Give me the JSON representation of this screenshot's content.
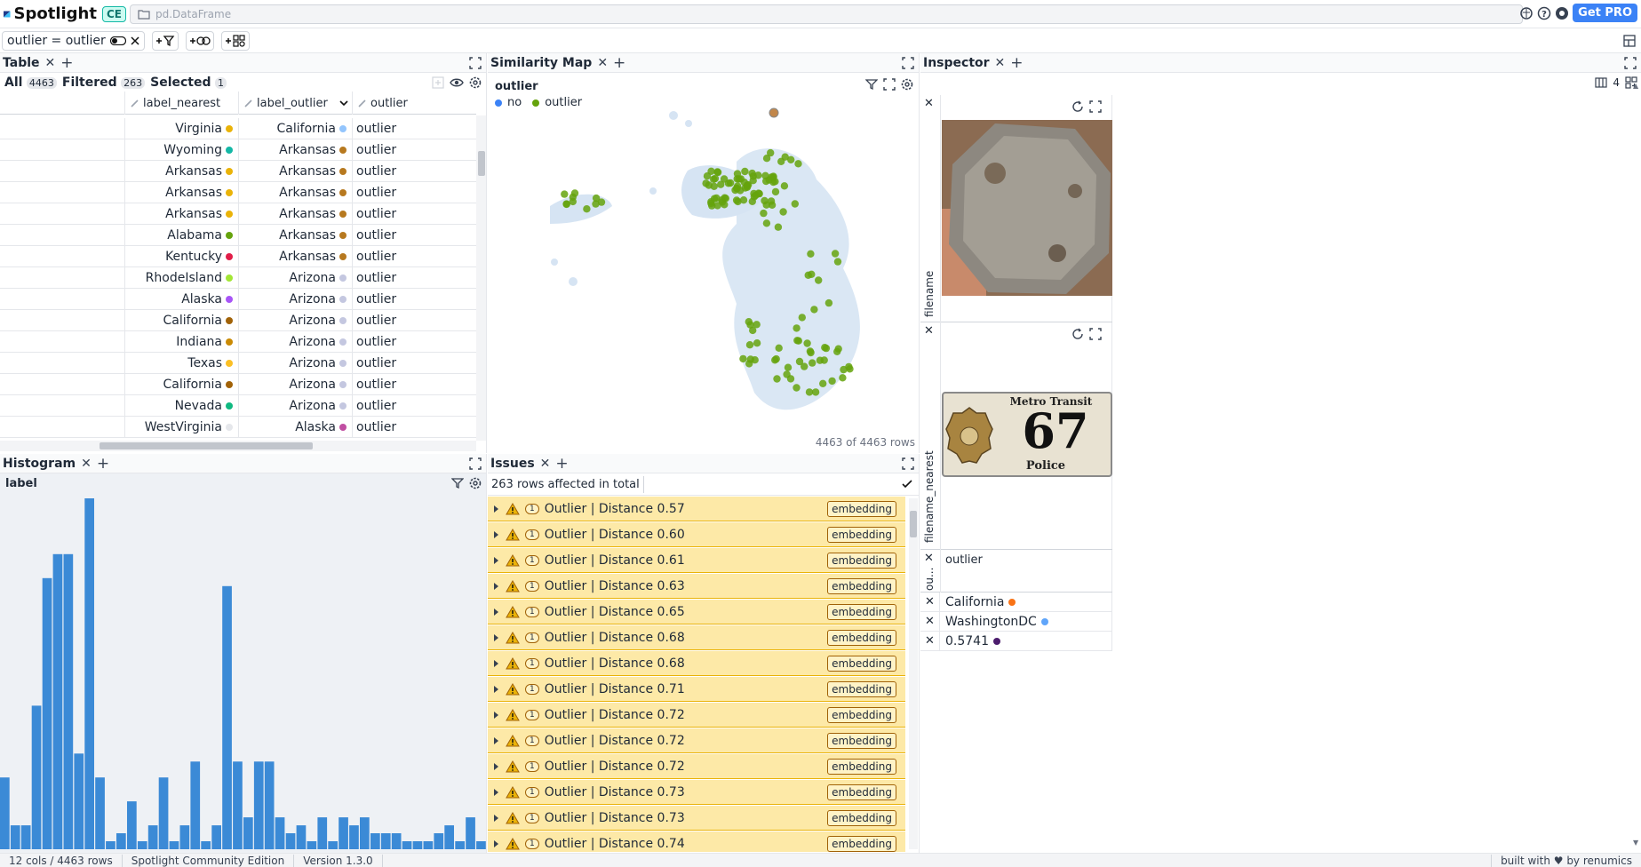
{
  "app": {
    "name": "Spotlight",
    "edition_badge": "CE",
    "path": "pd.DataFrame",
    "get_pro": "Get PRO"
  },
  "filter": {
    "text": "outlier = outlier"
  },
  "table": {
    "title": "Table",
    "tabs": {
      "all_label": "All",
      "all_count": "4463",
      "filtered_label": "Filtered",
      "filtered_count": "263",
      "selected_label": "Selected",
      "selected_count": "1"
    },
    "columns": [
      "label_nearest",
      "label_outlier",
      "outlier"
    ],
    "rows": [
      {
        "nearest": "Virginia",
        "nearest_color": "#eab308",
        "outlier_label": "California",
        "outlier_color": "#93c5fd",
        "outlier": "outlier"
      },
      {
        "nearest": "Wyoming",
        "nearest_color": "#14b8a6",
        "outlier_label": "Arkansas",
        "outlier_color": "#b7791f",
        "outlier": "outlier"
      },
      {
        "nearest": "Arkansas",
        "nearest_color": "#eab308",
        "outlier_label": "Arkansas",
        "outlier_color": "#b7791f",
        "outlier": "outlier"
      },
      {
        "nearest": "Arkansas",
        "nearest_color": "#eab308",
        "outlier_label": "Arkansas",
        "outlier_color": "#b7791f",
        "outlier": "outlier"
      },
      {
        "nearest": "Arkansas",
        "nearest_color": "#eab308",
        "outlier_label": "Arkansas",
        "outlier_color": "#b7791f",
        "outlier": "outlier"
      },
      {
        "nearest": "Alabama",
        "nearest_color": "#65a30d",
        "outlier_label": "Arkansas",
        "outlier_color": "#b7791f",
        "outlier": "outlier"
      },
      {
        "nearest": "Kentucky",
        "nearest_color": "#e11d48",
        "outlier_label": "Arkansas",
        "outlier_color": "#b7791f",
        "outlier": "outlier"
      },
      {
        "nearest": "RhodeIsland",
        "nearest_color": "#a3e635",
        "outlier_label": "Arizona",
        "outlier_color": "#c4c7e0",
        "outlier": "outlier"
      },
      {
        "nearest": "Alaska",
        "nearest_color": "#a855f7",
        "outlier_label": "Arizona",
        "outlier_color": "#c4c7e0",
        "outlier": "outlier"
      },
      {
        "nearest": "California",
        "nearest_color": "#a16207",
        "outlier_label": "Arizona",
        "outlier_color": "#c4c7e0",
        "outlier": "outlier"
      },
      {
        "nearest": "Indiana",
        "nearest_color": "#ca8a04",
        "outlier_label": "Arizona",
        "outlier_color": "#c4c7e0",
        "outlier": "outlier"
      },
      {
        "nearest": "Texas",
        "nearest_color": "#fbbf24",
        "outlier_label": "Arizona",
        "outlier_color": "#c4c7e0",
        "outlier": "outlier"
      },
      {
        "nearest": "California",
        "nearest_color": "#a16207",
        "outlier_label": "Arizona",
        "outlier_color": "#c4c7e0",
        "outlier": "outlier"
      },
      {
        "nearest": "Nevada",
        "nearest_color": "#10b981",
        "outlier_label": "Arizona",
        "outlier_color": "#c4c7e0",
        "outlier": "outlier"
      },
      {
        "nearest": "WestVirginia",
        "nearest_color": "#e5e7eb",
        "outlier_label": "Alaska",
        "outlier_color": "#c04ea2",
        "outlier": "outlier"
      }
    ]
  },
  "similarity_map": {
    "title": "Similarity Map",
    "legend_title": "outlier",
    "legend": [
      {
        "label": "no",
        "color": "#3b82f6"
      },
      {
        "label": "outlier",
        "color": "#65a30d"
      }
    ],
    "footer": "4463 of 4463 rows"
  },
  "histogram": {
    "title": "Histogram",
    "column": "label",
    "bar_color": "#3b8ad6"
  },
  "chart_data": {
    "type": "bar",
    "title": "",
    "xlabel": "",
    "ylabel": "",
    "values": [
      9,
      3,
      3,
      18,
      34,
      37,
      37,
      12,
      44,
      9,
      1,
      2,
      6,
      1,
      3,
      9,
      1,
      3,
      11,
      1,
      3,
      33,
      11,
      4,
      11,
      11,
      4,
      2,
      3,
      1,
      4,
      1,
      4,
      3,
      4,
      2,
      2,
      2,
      1,
      1,
      1,
      2,
      3,
      1,
      4,
      1
    ]
  },
  "issues": {
    "title": "Issues",
    "summary": "263 rows affected in total",
    "items": [
      {
        "text": "Outlier | Distance 0.57",
        "tag": "embedding",
        "count": "1"
      },
      {
        "text": "Outlier | Distance 0.60",
        "tag": "embedding",
        "count": "1"
      },
      {
        "text": "Outlier | Distance 0.61",
        "tag": "embedding",
        "count": "1"
      },
      {
        "text": "Outlier | Distance 0.63",
        "tag": "embedding",
        "count": "1"
      },
      {
        "text": "Outlier | Distance 0.65",
        "tag": "embedding",
        "count": "1"
      },
      {
        "text": "Outlier | Distance 0.68",
        "tag": "embedding",
        "count": "1"
      },
      {
        "text": "Outlier | Distance 0.68",
        "tag": "embedding",
        "count": "1"
      },
      {
        "text": "Outlier | Distance 0.71",
        "tag": "embedding",
        "count": "1"
      },
      {
        "text": "Outlier | Distance 0.72",
        "tag": "embedding",
        "count": "1"
      },
      {
        "text": "Outlier | Distance 0.72",
        "tag": "embedding",
        "count": "1"
      },
      {
        "text": "Outlier | Distance 0.72",
        "tag": "embedding",
        "count": "1"
      },
      {
        "text": "Outlier | Distance 0.73",
        "tag": "embedding",
        "count": "1"
      },
      {
        "text": "Outlier | Distance 0.73",
        "tag": "embedding",
        "count": "1"
      },
      {
        "text": "Outlier | Distance 0.74",
        "tag": "embedding",
        "count": "1"
      }
    ]
  },
  "inspector": {
    "title": "Inspector",
    "columns_count": "4",
    "field1_label": "filename",
    "field2_label": "filename_nearest",
    "field3_label": "ou...",
    "plate_line1": "Metro Transit",
    "plate_number": "67",
    "plate_line2": "Police",
    "outlier_value": "outlier",
    "rows": [
      {
        "value": "California",
        "color": "#f97316"
      },
      {
        "value": "WashingtonDC",
        "color": "#60a5fa"
      },
      {
        "value": "0.5741",
        "color": "#4c1d6d"
      }
    ]
  },
  "statusbar": {
    "shape": "12 cols / 4463 rows",
    "edition": "Spotlight Community Edition",
    "version": "Version 1.3.0",
    "credit": "built with ♥ by renumics"
  }
}
